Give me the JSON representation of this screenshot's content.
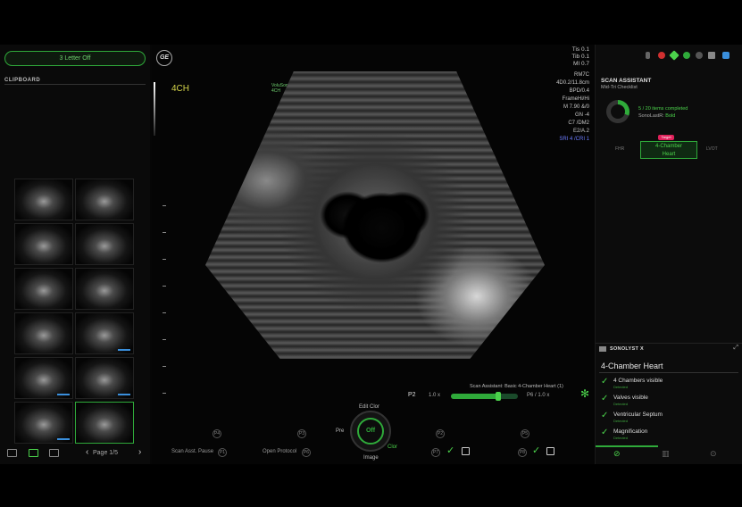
{
  "left_panel": {
    "pill_label": "3 Letter Off",
    "clipboard_label": "CLIPBOARD",
    "page_label": "Page 1/5",
    "prev_arrow": "‹",
    "next_arrow": "›"
  },
  "image": {
    "logo": "GE",
    "mode": "4CH",
    "overlay_small": [
      "VoluSon",
      "4CH"
    ],
    "top_readouts": [
      "Tis 0.1",
      "Tib 0.1",
      "MI 0.7"
    ],
    "params": [
      "RM7C",
      "4D0.2/11.8cm",
      "BPD/0.4",
      "FrameHi/Hi",
      "M 7.90  &/0",
      "GN -4",
      "C7 /DM2",
      "E2/A.2",
      "SRI 4 /CRI 1"
    ],
    "scan_header": "Scan Assistant: Basic 4-Chamber Heart (1)",
    "p2_label": "P2",
    "p2_value": "1.0 x",
    "pp_value": "P6 / 1.0 x",
    "star": "✻"
  },
  "controls": {
    "knob_center": "Off",
    "knob_top": "Edit Clor",
    "knob_left": "Pre",
    "knob_right": "Clor",
    "knob_bottom": "Image",
    "scan_asst_pause": "Scan Asst. Pause",
    "open_protocol": "Open Protocol",
    "softkey_labels": [
      "P4",
      "P3",
      "P2",
      "P5",
      "P1",
      "P6",
      "P7",
      "P8"
    ],
    "check": "✓"
  },
  "right_panel": {
    "scan_assistant_title": "SCAN ASSISTANT",
    "scan_assistant_sub": "Mid-Tri Checklist",
    "progress_text": "5 / 20 items completed",
    "sonolab_label": "SonoLastR:",
    "sonolab_value": "Bold",
    "target_badge": "Target",
    "target_label_1": "4-Chamber",
    "target_label_2": "Heart",
    "left_side": "FHR",
    "right_side": "LVOT",
    "sono_name": "SONOLYST X",
    "sono_close": "⤢",
    "view_title": "4-Chamber Heart",
    "checklist": [
      {
        "title": "4 Chambers visible",
        "status": "Detected"
      },
      {
        "title": "Valves visible",
        "status": "Detected"
      },
      {
        "title": "Ventricular Septum",
        "status": "Detected"
      },
      {
        "title": "Magnification",
        "status": "Detected"
      }
    ],
    "bottom_icons": [
      "⊘",
      "▥",
      "⊙"
    ]
  },
  "colors": {
    "accent_green": "#2faa3a",
    "bright_green": "#4bd24b",
    "target_pink": "#e0205a",
    "param_blue": "#6c7cff",
    "mode_yellow": "#d4d44a"
  }
}
